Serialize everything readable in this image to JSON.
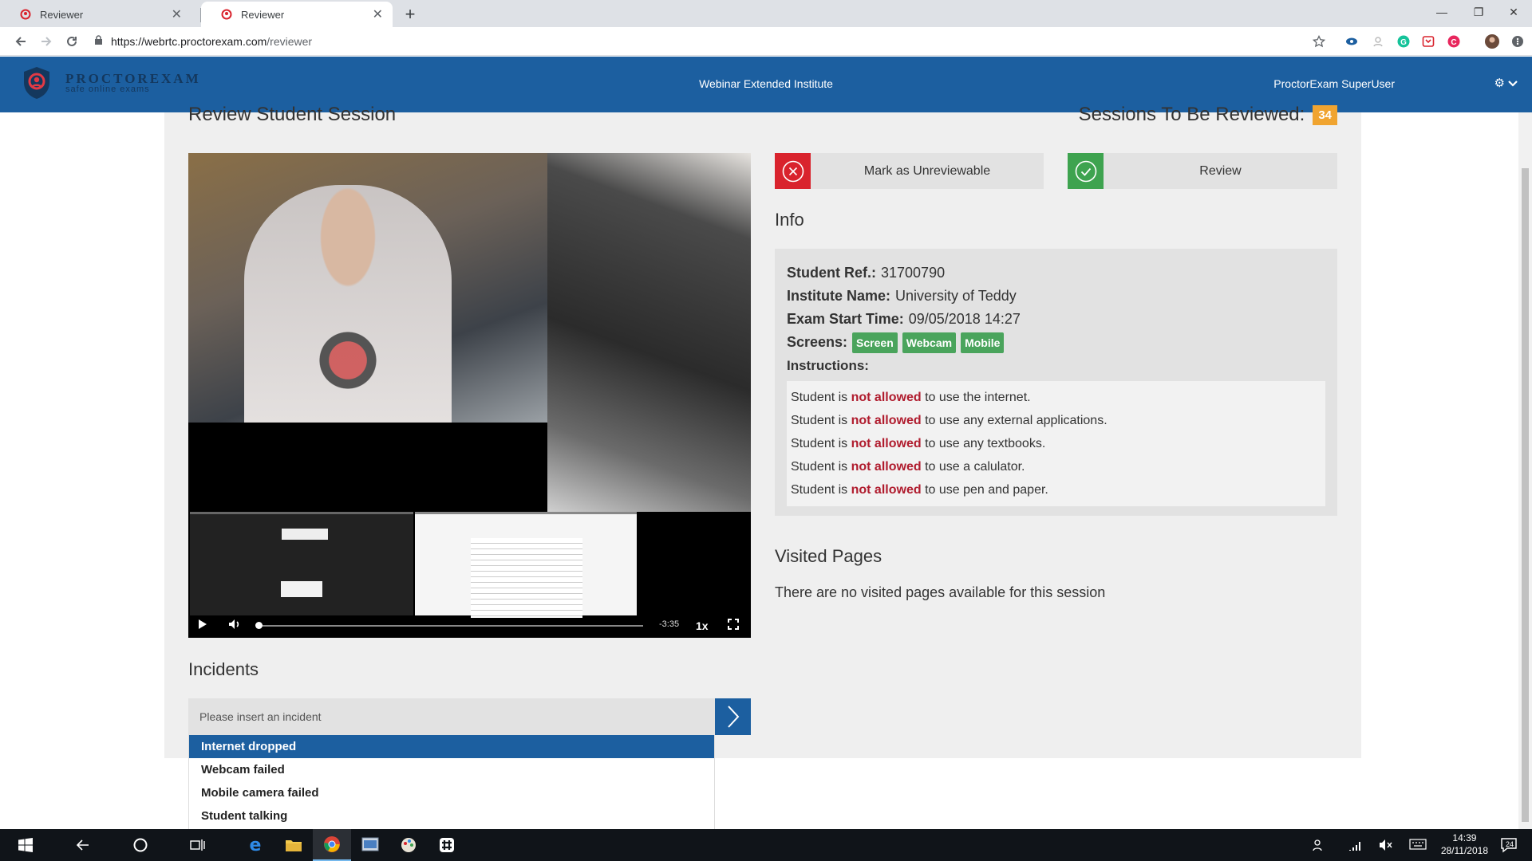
{
  "browser": {
    "tabs": [
      {
        "label": "Reviewer"
      },
      {
        "label": "Reviewer"
      }
    ],
    "url_host": "https://webrtc.proctorexam.com",
    "url_path": "/reviewer"
  },
  "header": {
    "logo_name": "PROCTOREXAM",
    "logo_tagline": "safe online exams",
    "institute": "Webinar Extended Institute",
    "user": "ProctorExam SuperUser"
  },
  "page": {
    "title": "Review Student Session",
    "to_review_label": "Sessions To Be Reviewed:",
    "to_review_count": "34"
  },
  "video": {
    "time_remaining": "-3:35",
    "speed": "1x",
    "progress": 0.0
  },
  "actions": {
    "unreviewable_label": "Mark as Unreviewable",
    "review_label": "Review"
  },
  "info": {
    "heading": "Info",
    "student_ref_label": "Student Ref.:",
    "student_ref": "31700790",
    "institute_label": "Institute Name:",
    "institute": "University of Teddy",
    "start_label": "Exam Start Time:",
    "start": "09/05/2018 14:27",
    "screens_label": "Screens:",
    "screens": [
      "Screen",
      "Webcam",
      "Mobile"
    ],
    "instructions_label": "Instructions:",
    "instructions": [
      {
        "pre": "Student is",
        "flag": "not allowed",
        "post": "to use the internet."
      },
      {
        "pre": "Student is",
        "flag": "not allowed",
        "post": "to use any external applications."
      },
      {
        "pre": "Student is",
        "flag": "not allowed",
        "post": "to use any textbooks."
      },
      {
        "pre": "Student is",
        "flag": "not allowed",
        "post": "to use a calulator."
      },
      {
        "pre": "Student is",
        "flag": "not allowed",
        "post": "to use pen and paper."
      }
    ]
  },
  "visited": {
    "heading": "Visited Pages",
    "empty": "There are no visited pages available for this session"
  },
  "incidents": {
    "heading": "Incidents",
    "placeholder": "Please insert an incident",
    "suggestions": [
      "Internet dropped",
      "Webcam failed",
      "Mobile camera failed",
      "Student talking"
    ]
  },
  "taskbar": {
    "time": "14:39",
    "date": "28/11/2018",
    "notifications": "24"
  },
  "colors": {
    "brand_blue": "#1c5fa0",
    "count_orange": "#f0a430",
    "danger_red": "#d9232d",
    "success_green": "#3ea34f",
    "badge_green": "#4aa45c",
    "not_allowed_red": "#b01c2e"
  }
}
